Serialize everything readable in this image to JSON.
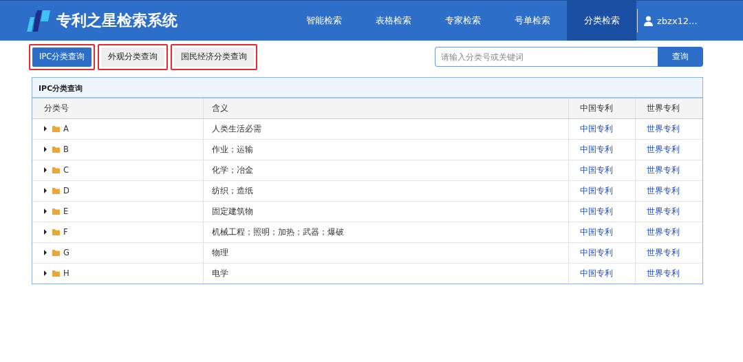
{
  "header": {
    "title": "专利之星检索系统",
    "nav": [
      {
        "label": "智能检索",
        "selected": false
      },
      {
        "label": "表格检索",
        "selected": false
      },
      {
        "label": "专家检索",
        "selected": false
      },
      {
        "label": "号单检索",
        "selected": false
      },
      {
        "label": "分类检索",
        "selected": true
      }
    ],
    "user": "zbzx12..."
  },
  "tabs": [
    {
      "label": "IPC分类查询",
      "selected": true,
      "highlighted": true
    },
    {
      "label": "外观分类查询",
      "selected": false,
      "highlighted": true
    },
    {
      "label": "国民经济分类查询",
      "selected": false,
      "highlighted": true
    }
  ],
  "search": {
    "placeholder": "请输入分类号或关键词",
    "button": "查询"
  },
  "panel": {
    "title": "IPC分类查询",
    "columns": [
      "分类号",
      "含义",
      "中国专利",
      "世界专利"
    ],
    "rows": [
      {
        "code": "A",
        "meaning": "人类生活必需",
        "expanded": false,
        "cn": "中国专利",
        "world": "世界专利"
      },
      {
        "code": "B",
        "meaning": "作业；运输",
        "expanded": false,
        "cn": "中国专利",
        "world": "世界专利"
      },
      {
        "code": "C",
        "meaning": "化学；冶金",
        "expanded": false,
        "cn": "中国专利",
        "world": "世界专利"
      },
      {
        "code": "D",
        "meaning": "纺织；造纸",
        "expanded": false,
        "cn": "中国专利",
        "world": "世界专利"
      },
      {
        "code": "E",
        "meaning": "固定建筑物",
        "expanded": false,
        "cn": "中国专利",
        "world": "世界专利"
      },
      {
        "code": "F",
        "meaning": "机械工程；照明；加热；武器；爆破",
        "expanded": false,
        "cn": "中国专利",
        "world": "世界专利"
      },
      {
        "code": "G",
        "meaning": "物理",
        "expanded": false,
        "cn": "中国专利",
        "world": "世界专利"
      },
      {
        "code": "H",
        "meaning": "电学",
        "expanded": false,
        "cn": "中国专利",
        "world": "世界专利"
      }
    ]
  }
}
